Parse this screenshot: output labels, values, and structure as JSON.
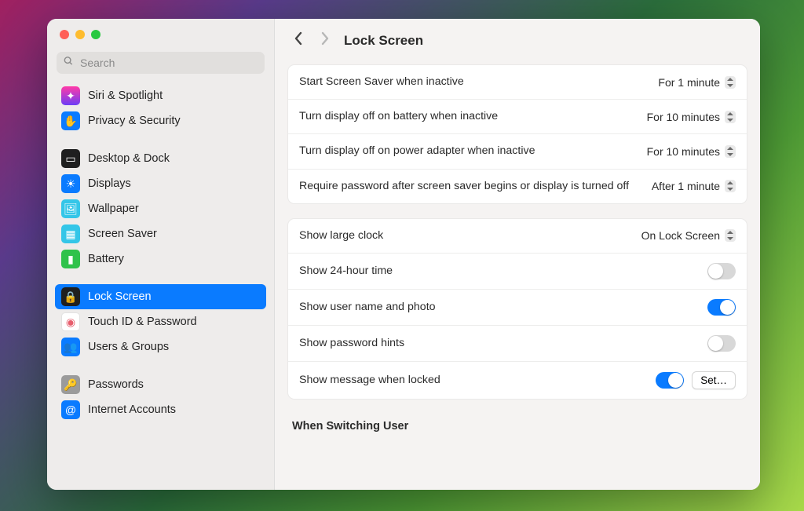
{
  "search": {
    "placeholder": "Search"
  },
  "sidebar": {
    "items": [
      {
        "label": "Siri & Spotlight",
        "icon_bg": "linear-gradient(180deg,#ff3aa7,#6d3df6)",
        "glyph": "✦"
      },
      {
        "label": "Privacy & Security",
        "icon_bg": "#0a7bff",
        "glyph": "✋"
      },
      {
        "gap": true
      },
      {
        "label": "Desktop & Dock",
        "icon_bg": "#1f1f1f",
        "glyph": "▭"
      },
      {
        "label": "Displays",
        "icon_bg": "#0a7bff",
        "glyph": "☀"
      },
      {
        "label": "Wallpaper",
        "icon_bg": "#34c6e8",
        "glyph": "🖼"
      },
      {
        "label": "Screen Saver",
        "icon_bg": "#34c6e8",
        "glyph": "▦"
      },
      {
        "label": "Battery",
        "icon_bg": "#2fc24b",
        "glyph": "▮"
      },
      {
        "gap": true
      },
      {
        "label": "Lock Screen",
        "icon_bg": "#1f1f1f",
        "glyph": "🔒",
        "selected": true
      },
      {
        "label": "Touch ID & Password",
        "icon_bg": "#ffffff",
        "glyph": "◉",
        "glyph_color": "#e75d6c",
        "border": "#e2e2e2"
      },
      {
        "label": "Users & Groups",
        "icon_bg": "#0a7bff",
        "glyph": "👥"
      },
      {
        "gap": true
      },
      {
        "label": "Passwords",
        "icon_bg": "#9b9b9b",
        "glyph": "🔑"
      },
      {
        "label": "Internet Accounts",
        "icon_bg": "#0a7bff",
        "glyph": "@"
      }
    ]
  },
  "header": {
    "title": "Lock Screen"
  },
  "group1": {
    "rows": [
      {
        "label": "Start Screen Saver when inactive",
        "value": "For 1 minute"
      },
      {
        "label": "Turn display off on battery when inactive",
        "value": "For 10 minutes"
      },
      {
        "label": "Turn display off on power adapter when inactive",
        "value": "For 10 minutes"
      },
      {
        "label": "Require password after screen saver begins or display is turned off",
        "value": "After 1 minute"
      }
    ]
  },
  "group2": {
    "rows": [
      {
        "label": "Show large clock",
        "type": "popup",
        "value": "On Lock Screen"
      },
      {
        "label": "Show 24-hour time",
        "type": "toggle",
        "on": false
      },
      {
        "label": "Show user name and photo",
        "type": "toggle",
        "on": true
      },
      {
        "label": "Show password hints",
        "type": "toggle",
        "on": false
      },
      {
        "label": "Show message when locked",
        "type": "toggle+btn",
        "on": true,
        "btn": "Set…"
      }
    ]
  },
  "heading": "When Switching User"
}
